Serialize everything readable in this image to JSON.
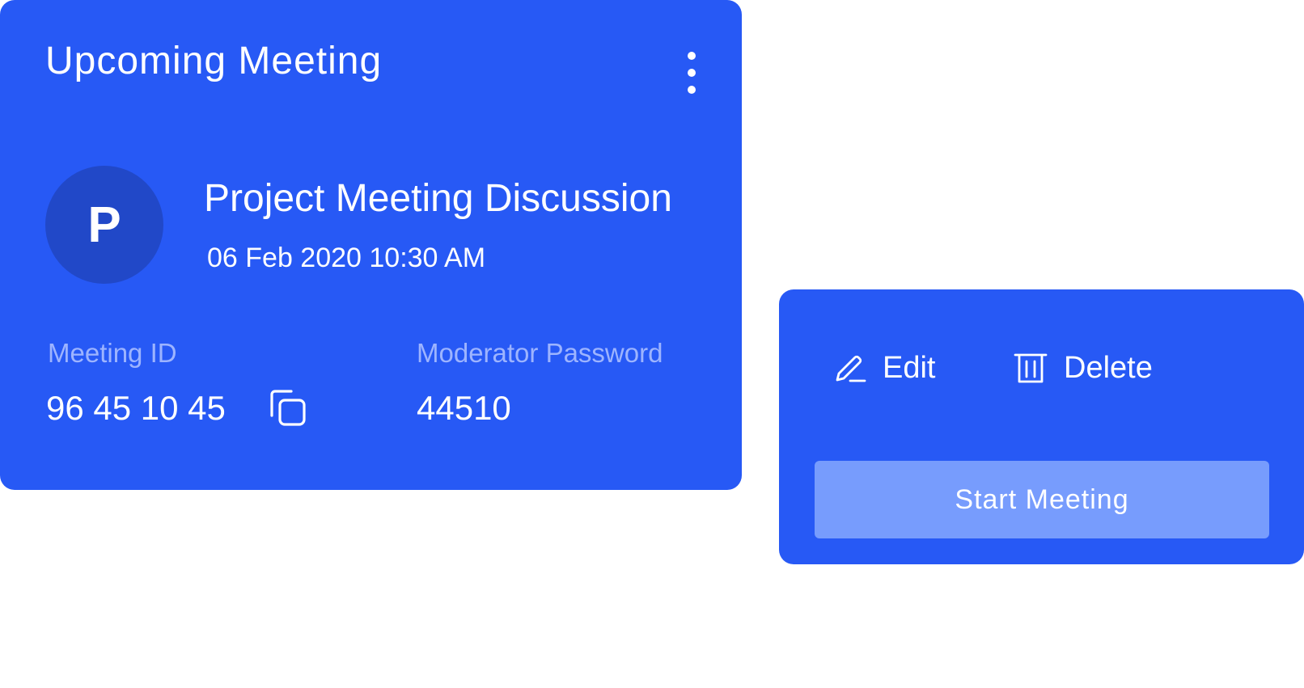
{
  "meeting_card": {
    "title": "Upcoming Meeting",
    "menu_icon": "kebab-menu-icon",
    "avatar_initial": "P",
    "meeting_name": "Project Meeting Discussion",
    "meeting_datetime": "06 Feb 2020 10:30 AM",
    "meeting_id_label": "Meeting ID",
    "meeting_id_value": "96 45 10 45",
    "copy_icon": "copy-icon",
    "moderator_password_label": "Moderator Password",
    "moderator_password_value": "44510"
  },
  "actions_card": {
    "edit_label": "Edit",
    "edit_icon": "pencil-icon",
    "delete_label": "Delete",
    "delete_icon": "trash-icon",
    "start_button_label": "Start Meeting"
  },
  "colors": {
    "card_background": "#2759F5",
    "avatar_background": "#2148C8",
    "muted_label": "#9DB4FF",
    "start_button_background": "#779CFD",
    "text": "#FFFFFF"
  }
}
